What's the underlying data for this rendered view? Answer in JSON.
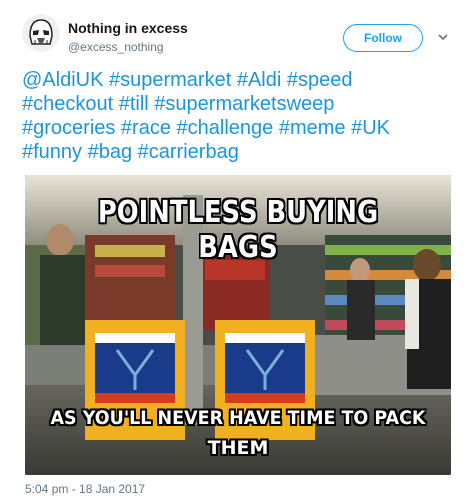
{
  "author": {
    "display_name": "Nothing in excess",
    "handle": "@excess_nothing",
    "avatar_icon": "stormtrooper-helmet-icon"
  },
  "actions": {
    "follow_label": "Follow",
    "menu_icon": "chevron-down-icon"
  },
  "tweet": {
    "lines": [
      "@AldiUK #supermarket #Aldi #speed",
      "#checkout #till #supermarketsweep",
      "#groceries #race #challenge #meme #UK",
      "#funny #bag #carrierbag"
    ],
    "link_color": "#1b95e0"
  },
  "media": {
    "top_caption": "POINTLESS BUYING BAGS",
    "bottom_caption_line1": "AS YOU'LL NEVER HAVE TIME TO PACK",
    "bottom_caption_line2": "THEM"
  },
  "meta": {
    "timestamp": "5:04 pm - 18 Jan 2017"
  },
  "colors": {
    "accent": "#1da1f2",
    "muted": "#657786"
  }
}
